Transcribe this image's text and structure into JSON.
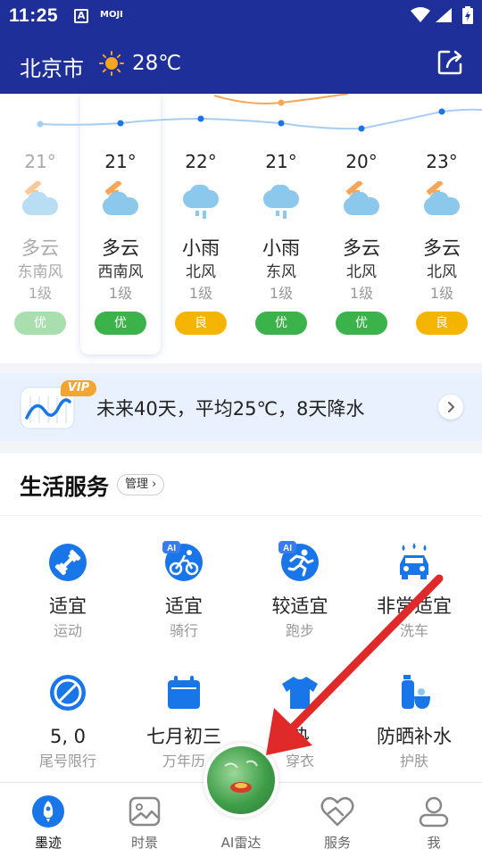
{
  "status_bar": {
    "time": "11:25",
    "app_badge_a": "A",
    "app_badge_moji": "MOJI"
  },
  "header": {
    "city": "北京市",
    "temperature": "28℃"
  },
  "forecast": [
    {
      "temp": "21°",
      "cond": "多云",
      "wind": "东南风",
      "level": "1级",
      "aqi": "优",
      "aqi_class": "good",
      "past": true,
      "icon": "partly-cloudy-icon"
    },
    {
      "temp": "21°",
      "cond": "多云",
      "wind": "西南风",
      "level": "1级",
      "aqi": "优",
      "aqi_class": "good",
      "past": false,
      "icon": "partly-cloudy-icon"
    },
    {
      "temp": "22°",
      "cond": "小雨",
      "wind": "北风",
      "level": "1级",
      "aqi": "良",
      "aqi_class": "mid",
      "past": false,
      "icon": "light-rain-icon"
    },
    {
      "temp": "21°",
      "cond": "小雨",
      "wind": "东风",
      "level": "1级",
      "aqi": "优",
      "aqi_class": "good",
      "past": false,
      "icon": "light-rain-icon"
    },
    {
      "temp": "20°",
      "cond": "多云",
      "wind": "北风",
      "level": "1级",
      "aqi": "优",
      "aqi_class": "good",
      "past": false,
      "icon": "partly-cloudy-icon"
    },
    {
      "temp": "23°",
      "cond": "多云",
      "wind": "北风",
      "level": "1级",
      "aqi": "良",
      "aqi_class": "mid",
      "past": false,
      "icon": "partly-cloudy-icon"
    }
  ],
  "vip_banner": {
    "tag": "VIP",
    "text": "未来40天，平均25℃，8天降水"
  },
  "life_services": {
    "title": "生活服务",
    "manage_label": "管理",
    "items": [
      {
        "value": "适宜",
        "label": "运动",
        "icon": "dumbbell-icon"
      },
      {
        "value": "适宜",
        "label": "骑行",
        "icon": "cycling-icon"
      },
      {
        "value": "较适宜",
        "label": "跑步",
        "icon": "running-icon"
      },
      {
        "value": "非常适宜",
        "label": "洗车",
        "icon": "car-wash-icon"
      },
      {
        "value": "5, 0",
        "label": "尾号限行",
        "icon": "no-entry-icon"
      },
      {
        "value": "七月初三",
        "label": "万年历",
        "icon": "calendar-icon"
      },
      {
        "value": "热",
        "label": "穿衣",
        "icon": "tshirt-icon"
      },
      {
        "value": "防晒补水",
        "label": "护肤",
        "icon": "skincare-icon"
      }
    ],
    "ai_badge": "AI"
  },
  "bottom_nav": [
    {
      "label": "墨迹",
      "icon": "rocket-icon",
      "active": true
    },
    {
      "label": "时景",
      "icon": "photo-icon",
      "active": false
    },
    {
      "label": "AI雷达",
      "icon": "radar-icon",
      "active": false
    },
    {
      "label": "服务",
      "icon": "heart-hands-icon",
      "active": false
    },
    {
      "label": "我",
      "icon": "user-icon",
      "active": false
    }
  ],
  "colors": {
    "header_bg": "#1e2f99",
    "accent": "#1976e8",
    "aqi_good": "#3cb34a",
    "aqi_moderate": "#f5b400",
    "annotation_arrow": "#e02a2a"
  }
}
